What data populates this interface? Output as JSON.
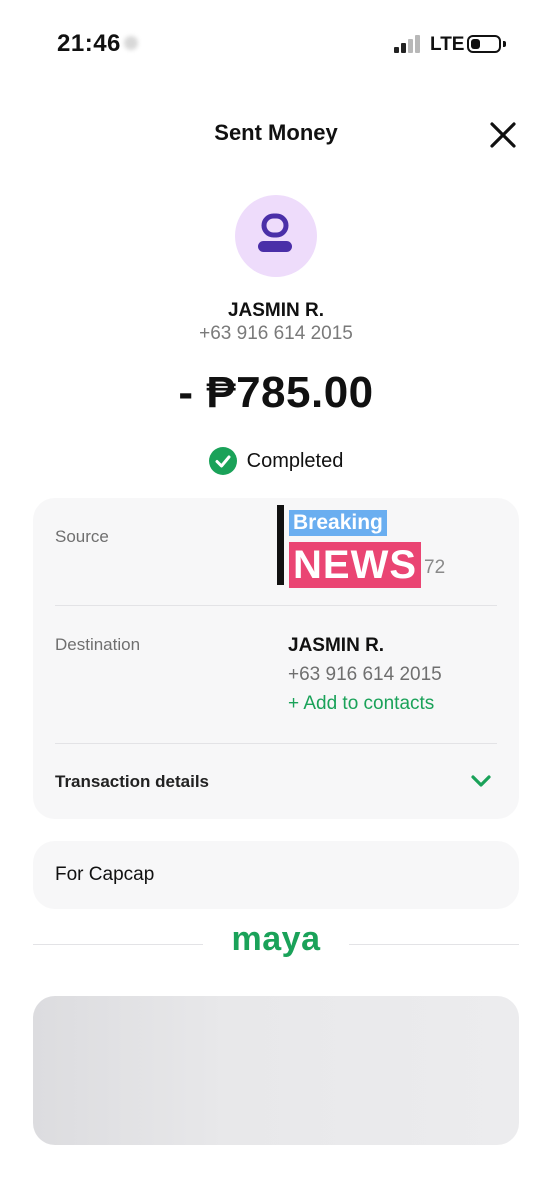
{
  "status_bar": {
    "time": "21:46",
    "network": "LTE"
  },
  "header": {
    "title": "Sent Money"
  },
  "recipient": {
    "name": "JASMIN R.",
    "phone": "+63 916 614 2015"
  },
  "amount": "- ₱785.00",
  "status": {
    "label": "Completed",
    "color": "#1aa259"
  },
  "details": {
    "source_label": "Source",
    "source_value_visible": "72",
    "sticker": {
      "breaking": "Breaking",
      "news": "NEWS"
    },
    "destination_label": "Destination",
    "destination_name": "JASMIN R.",
    "destination_phone": "+63 916 614 2015",
    "add_contacts": "+ Add to contacts",
    "transaction_details": "Transaction details"
  },
  "note": "For Capcap",
  "brand": "maya",
  "colors": {
    "accent_green": "#1aa259",
    "avatar_bg": "#eedcfb",
    "avatar_icon": "#4a2fa8",
    "card_bg": "#f7f7f8"
  }
}
